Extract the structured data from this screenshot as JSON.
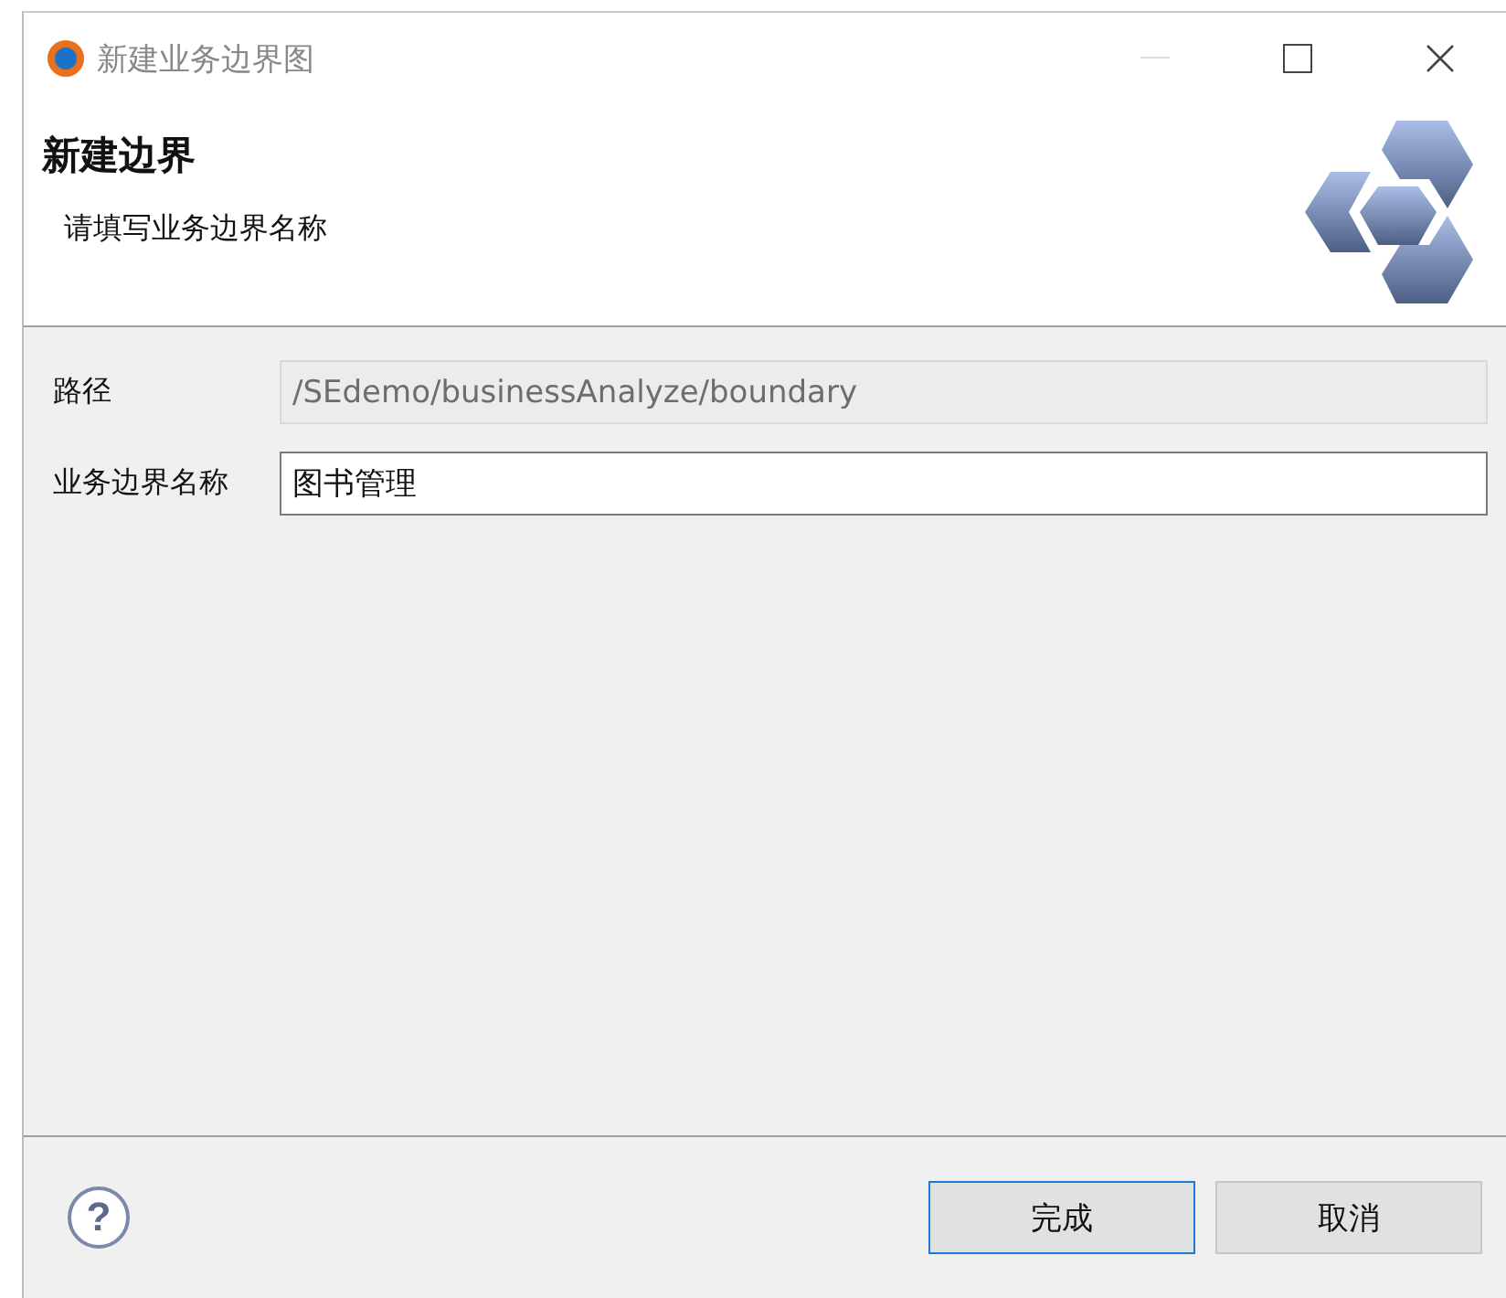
{
  "window": {
    "title": "新建业务边界图",
    "minimize_disabled": true
  },
  "header": {
    "title": "新建边界",
    "description": "请填写业务边界名称"
  },
  "fields": [
    {
      "label": "路径",
      "value": "/SEdemo/businessAnalyze/boundary",
      "disabled": true
    },
    {
      "label": "业务边界名称",
      "value": "图书管理",
      "disabled": false
    }
  ],
  "help": {
    "label": "?"
  },
  "buttons": [
    {
      "label": "完成",
      "focused": true
    },
    {
      "label": "取消",
      "focused": false
    }
  ]
}
